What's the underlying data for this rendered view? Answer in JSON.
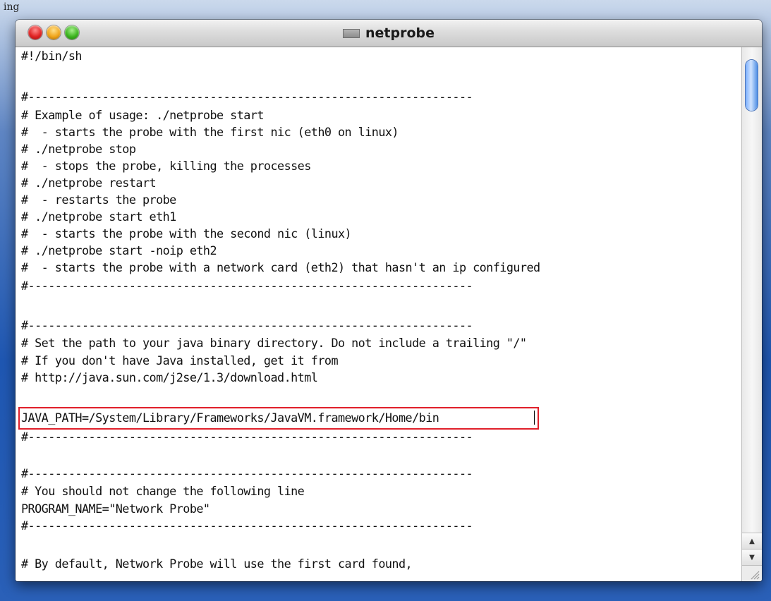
{
  "desktop": {
    "fragment_text": "ing"
  },
  "window": {
    "title": "netprobe",
    "lines": [
      "#!/bin/sh",
      "",
      "#------------------------------------------------------------------",
      "# Example of usage: ./netprobe start",
      "#  - starts the probe with the first nic (eth0 on linux)",
      "# ./netprobe stop",
      "#  - stops the probe, killing the processes",
      "# ./netprobe restart",
      "#  - restarts the probe",
      "# ./netprobe start eth1",
      "#  - starts the probe with the second nic (linux)",
      "# ./netprobe start -noip eth2",
      "#  - starts the probe with a network card (eth2) that hasn't an ip configured",
      "#------------------------------------------------------------------",
      "",
      "#------------------------------------------------------------------",
      "# Set the path to your java binary directory. Do not include a trailing \"/\"",
      "# If you don't have Java installed, get it from",
      "# http://java.sun.com/j2se/1.3/download.html",
      "JAVA_PATH=/System/Library/Frameworks/JavaVM.framework/Home/bin",
      "#------------------------------------------------------------------",
      "",
      "#------------------------------------------------------------------",
      "# You should not change the following line",
      "PROGRAM_NAME=\"Network Probe\"",
      "#------------------------------------------------------------------",
      "",
      "# By default, Network Probe will use the first card found,"
    ]
  },
  "icons": {
    "close": "close-button-icon",
    "minimize": "minimize-button-icon",
    "zoom": "zoom-button-icon",
    "proxy": "document-proxy-icon",
    "scroll_up": "scroll-up-arrow-icon",
    "scroll_down": "scroll-down-arrow-icon",
    "resize": "resize-grip-icon"
  },
  "colors": {
    "highlight_border": "#e0202a",
    "scroll_thumb": "#7cb0ff"
  }
}
